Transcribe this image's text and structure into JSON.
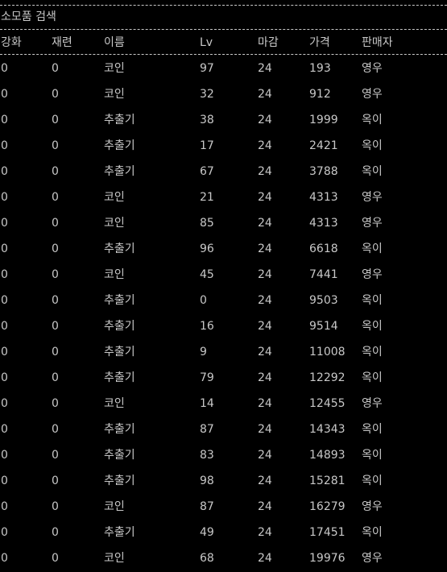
{
  "title": "소모품 검색",
  "columns": [
    "강화",
    "재련",
    "이름",
    "Lv",
    "마감",
    "가격",
    "판매자"
  ],
  "rows": [
    [
      "0",
      "0",
      "코인",
      "97",
      "24",
      "193",
      "영우"
    ],
    [
      "0",
      "0",
      "코인",
      "32",
      "24",
      "912",
      "영우"
    ],
    [
      "0",
      "0",
      "추출기",
      "38",
      "24",
      "1999",
      "옥이"
    ],
    [
      "0",
      "0",
      "추출기",
      "17",
      "24",
      "2421",
      "옥이"
    ],
    [
      "0",
      "0",
      "추출기",
      "67",
      "24",
      "3788",
      "옥이"
    ],
    [
      "0",
      "0",
      "코인",
      "21",
      "24",
      "4313",
      "영우"
    ],
    [
      "0",
      "0",
      "코인",
      "85",
      "24",
      "4313",
      "영우"
    ],
    [
      "0",
      "0",
      "추출기",
      "96",
      "24",
      "6618",
      "옥이"
    ],
    [
      "0",
      "0",
      "코인",
      "45",
      "24",
      "7441",
      "영우"
    ],
    [
      "0",
      "0",
      "추출기",
      "0",
      "24",
      "9503",
      "옥이"
    ],
    [
      "0",
      "0",
      "추출기",
      "16",
      "24",
      "9514",
      "옥이"
    ],
    [
      "0",
      "0",
      "추출기",
      "9",
      "24",
      "11008",
      "옥이"
    ],
    [
      "0",
      "0",
      "추출기",
      "79",
      "24",
      "12292",
      "옥이"
    ],
    [
      "0",
      "0",
      "코인",
      "14",
      "24",
      "12455",
      "영우"
    ],
    [
      "0",
      "0",
      "추출기",
      "87",
      "24",
      "14343",
      "옥이"
    ],
    [
      "0",
      "0",
      "추출기",
      "83",
      "24",
      "14893",
      "옥이"
    ],
    [
      "0",
      "0",
      "추출기",
      "98",
      "24",
      "15281",
      "옥이"
    ],
    [
      "0",
      "0",
      "코인",
      "87",
      "24",
      "16279",
      "영우"
    ],
    [
      "0",
      "0",
      "추출기",
      "49",
      "24",
      "17451",
      "옥이"
    ],
    [
      "0",
      "0",
      "코인",
      "68",
      "24",
      "19976",
      "영우"
    ]
  ],
  "colors": {
    "background": "#000000",
    "text": "#c8c8c8"
  }
}
